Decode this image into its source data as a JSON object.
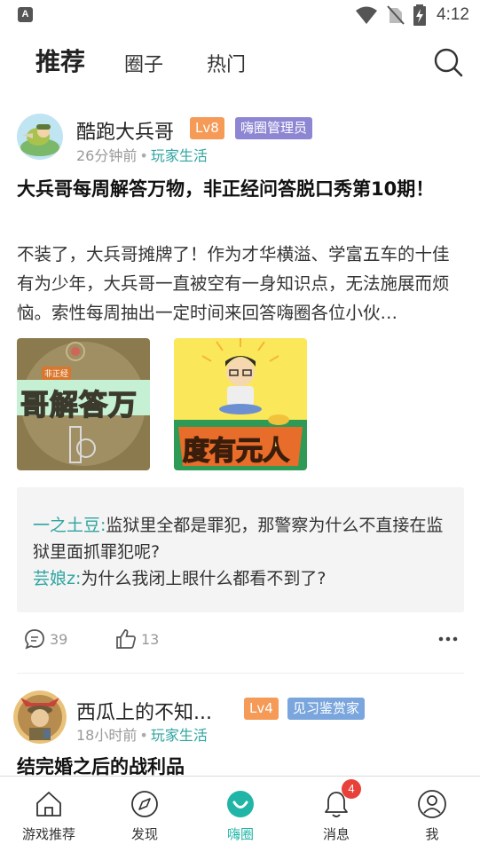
{
  "status_bar": {
    "time": "4:12",
    "app_icon_letter": "A"
  },
  "top_nav": {
    "tabs": [
      {
        "label": "推荐"
      },
      {
        "label": "圈子"
      },
      {
        "label": "热门"
      }
    ]
  },
  "posts": [
    {
      "username": "酷跑大兵哥",
      "level": "Lv8",
      "role": "嗨圈管理员",
      "time_ago": "26分钟前",
      "separator": "•",
      "category": "玩家生活",
      "title": "大兵哥每周解答万物，非正经问答脱口秀第10期！",
      "body": "不装了，大兵哥摊牌了！作为才华横溢、学富五车的十佳有为少年，大兵哥一直被空有一身知识点，无法施展而烦恼。索性每周抽出一定时间来回答嗨圈各位小伙…",
      "images": [
        {
          "text": "哥解答万",
          "tag": "非正经"
        },
        {
          "text": "度有元人"
        }
      ],
      "comments": [
        {
          "author": "一之土豆:",
          "text": "监狱里全都是罪犯，那警察为什么不直接在监狱里面抓罪犯呢?"
        },
        {
          "author": "芸娘z:",
          "text": "为什么我闭上眼什么都看不到了?"
        }
      ],
      "comment_count": "39",
      "like_count": "13"
    },
    {
      "username": "西瓜上的不知...",
      "level": "Lv4",
      "role": "见习鉴赏家",
      "time_ago": "18小时前",
      "separator": "•",
      "category": "玩家生活",
      "title": "结完婚之后的战利品"
    }
  ],
  "bottom_nav": {
    "items": [
      {
        "label": "游戏推荐"
      },
      {
        "label": "发现"
      },
      {
        "label": "嗨圈"
      },
      {
        "label": "消息",
        "badge": "4"
      },
      {
        "label": "我"
      }
    ]
  },
  "colors": {
    "accent": "#20b5a6",
    "level_badge": "#f59a57",
    "role_badge": "#8d86d3",
    "role_badge_2": "#7aa6dd",
    "notification": "#e8413a"
  }
}
